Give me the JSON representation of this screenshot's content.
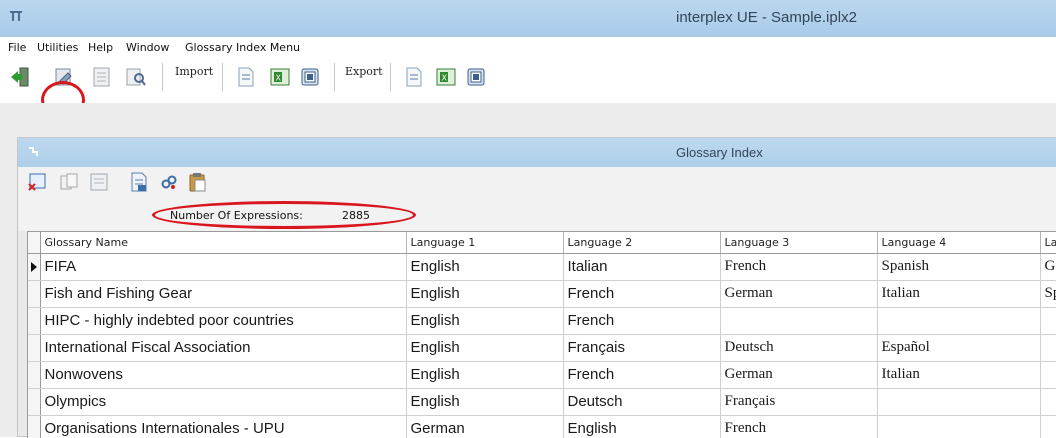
{
  "window": {
    "title": "interplex UE - Sample.iplx2"
  },
  "menu": {
    "file": "File",
    "utilities": "Utilities",
    "help": "Help",
    "window": "Window",
    "glossary_index_menu": "Glossary Index Menu"
  },
  "toolbar": {
    "import_label": "Import",
    "export_label": "Export"
  },
  "glossary_window": {
    "title": "Glossary Index",
    "count_label": "Number Of Expressions:",
    "count_value": "2885"
  },
  "grid": {
    "columns": [
      "Glossary Name",
      "Language 1",
      "Language 2",
      "Language 3",
      "Language 4",
      "La"
    ],
    "rows": [
      [
        "FIFA",
        "English",
        "Italian",
        "French",
        "Spanish",
        "G"
      ],
      [
        "Fish and Fishing Gear",
        "English",
        "French",
        "German",
        "Italian",
        "Sp"
      ],
      [
        "HIPC - highly indebted poor countries",
        "English",
        "French",
        "",
        "",
        ""
      ],
      [
        "International Fiscal Association",
        "English",
        "Français",
        "Deutsch",
        "Español",
        ""
      ],
      [
        "Nonwovens",
        "English",
        "French",
        "German",
        "Italian",
        ""
      ],
      [
        "Olympics",
        "English",
        "Deutsch",
        "Français",
        "",
        ""
      ],
      [
        "Organisations Internationales - UPU",
        "German",
        "English",
        "French",
        "",
        ""
      ]
    ]
  },
  "colors": {
    "title_bar": "#aecfe9",
    "highlight": "#d9161e"
  },
  "icons": [
    "app-icon",
    "exit-icon",
    "glossary-index-icon",
    "properties-icon",
    "search-icon",
    "document-icon",
    "excel-icon",
    "database-icon"
  ]
}
